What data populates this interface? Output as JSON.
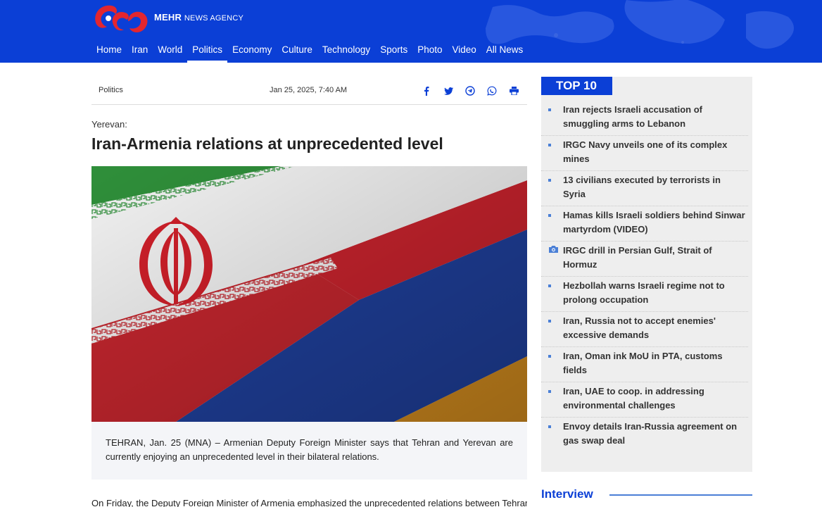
{
  "brand": {
    "name": "MEHR",
    "suffix": "NEWS AGENCY"
  },
  "nav": [
    {
      "label": "Home"
    },
    {
      "label": "Iran"
    },
    {
      "label": "World"
    },
    {
      "label": "Politics",
      "active": true
    },
    {
      "label": "Economy"
    },
    {
      "label": "Culture"
    },
    {
      "label": "Technology"
    },
    {
      "label": "Sports"
    },
    {
      "label": "Photo"
    },
    {
      "label": "Video"
    },
    {
      "label": "All News"
    }
  ],
  "article": {
    "category": "Politics",
    "date": "Jan 25, 2025, 7:40 AM",
    "dateline": "Yerevan:",
    "title": "Iran-Armenia relations at unprecedented level",
    "lead": "TEHRAN, Jan. 25 (MNA) – Armenian Deputy Foreign Minister says that Tehran and Yerevan are currently enjoying an unprecedented level in their bilateral relations.",
    "body_first_line": "On Friday, the Deputy Foreign Minister of Armenia emphasized the unprecedented relations between Tehran"
  },
  "share_icons": [
    "facebook-icon",
    "twitter-icon",
    "telegram-icon",
    "whatsapp-icon",
    "print-icon"
  ],
  "sidebar": {
    "top10_label": "TOP 10",
    "items": [
      {
        "text": "Iran rejects Israeli accusation of smuggling arms to Lebanon",
        "icon": "bullet"
      },
      {
        "text": "IRGC Navy unveils one of its complex mines",
        "icon": "bullet"
      },
      {
        "text": "13 civilians executed by terrorists in Syria",
        "icon": "bullet"
      },
      {
        "text": "Hamas kills Israeli soldiers behind Sinwar martyrdom (VIDEO)",
        "icon": "bullet"
      },
      {
        "text": "IRGC drill in Persian Gulf, Strait of Hormuz",
        "icon": "camera-icon"
      },
      {
        "text": "Hezbollah warns Israeli regime not to prolong occupation",
        "icon": "bullet"
      },
      {
        "text": "Iran, Russia not to accept enemies' excessive demands",
        "icon": "bullet"
      },
      {
        "text": "Iran, Oman ink MoU in PTA, customs fields",
        "icon": "bullet"
      },
      {
        "text": "Iran, UAE to coop. in addressing environmental challenges",
        "icon": "bullet"
      },
      {
        "text": "Envoy details Iran-Russia agreement on gas swap deal",
        "icon": "bullet"
      }
    ],
    "interview_label": "Interview"
  },
  "colors": {
    "brand_blue": "#0b3fd6",
    "logo_red": "#e3262f",
    "bullet_blue": "#4a7fd6",
    "sidebar_bg": "#eeeeee"
  }
}
